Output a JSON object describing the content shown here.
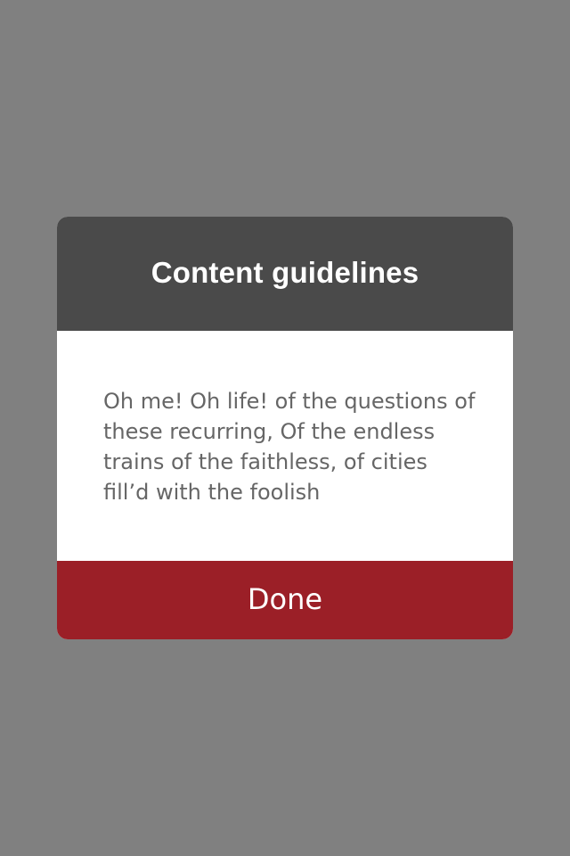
{
  "dialog": {
    "title": "Content guidelines",
    "body_text": "Oh me! Oh life! of the questions of these recurring, Of the endless trains of the faithless, of cities fill’d with the foolish",
    "done_label": "Done"
  },
  "colors": {
    "backdrop": "#808080",
    "header": "#4a4a4a",
    "body": "#ffffff",
    "footer_button": "#9b1f27",
    "body_text": "#666666",
    "title_text": "#ffffff"
  }
}
